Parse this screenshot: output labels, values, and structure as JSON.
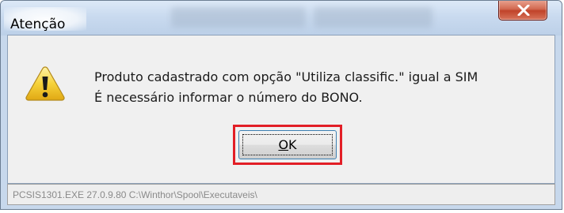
{
  "window": {
    "title": "Atenção",
    "close_glyph": "X"
  },
  "dialog": {
    "icon": "warning-icon",
    "message_line1": "Produto cadastrado com opção \"Utiliza classific.\" igual a SIM",
    "message_line2": "É necessário informar o número do BONO.",
    "ok_mnemonic": "O",
    "ok_rest": "K",
    "highlight_color": "#e21e26"
  },
  "statusbar": {
    "text": "PCSIS1301.EXE 27.0.9.80 C:\\Winthor\\Spool\\Executaveis\\"
  },
  "colors": {
    "title_bar": "#c9daef",
    "close_button": "#c0432a",
    "dialog_body": "#f0f0f0",
    "status_text": "#8a8a8a"
  }
}
